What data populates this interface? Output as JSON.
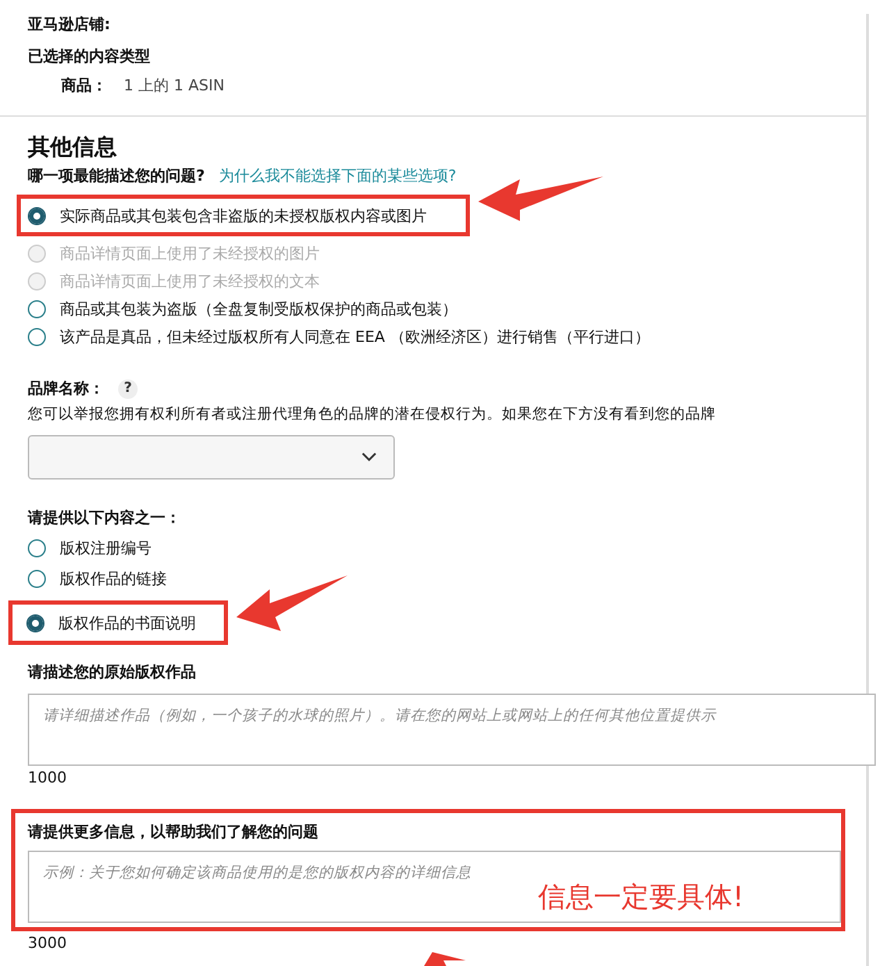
{
  "store_label": "亚马逊店铺:",
  "content_type_label": "已选择的内容类型",
  "item": {
    "label": "商品：",
    "value": "1 上的 1 ASIN"
  },
  "section_title": "其他信息",
  "question": {
    "label": "哪一项最能描述您的问题?",
    "link": "为什么我不能选择下面的某些选项?"
  },
  "issue_options": [
    {
      "label": "实际商品或其包装包含非盗版的未授权版权内容或图片",
      "selected": true,
      "disabled": false,
      "highlighted": true
    },
    {
      "label": "商品详情页面上使用了未经授权的图片",
      "selected": false,
      "disabled": true
    },
    {
      "label": "商品详情页面上使用了未经授权的文本",
      "selected": false,
      "disabled": true
    },
    {
      "label": "商品或其包装为盗版（全盘复制受版权保护的商品或包装）",
      "selected": false,
      "disabled": false
    },
    {
      "label": "该产品是真品，但未经过版权所有人同意在 EEA （欧洲经济区）进行销售（平行进口）",
      "selected": false,
      "disabled": false
    }
  ],
  "brand": {
    "label": "品牌名称：",
    "help": "?",
    "description": "您可以举报您拥有权利所有者或注册代理角色的品牌的潜在侵权行为。如果您在下方没有看到您的品牌"
  },
  "provide": {
    "label": "请提供以下内容之一：",
    "options": [
      {
        "label": "版权注册编号",
        "selected": false
      },
      {
        "label": "版权作品的链接",
        "selected": false
      },
      {
        "label": "版权作品的书面说明",
        "selected": true,
        "highlighted": true
      }
    ]
  },
  "describe": {
    "label": "请描述您的原始版权作品",
    "placeholder": "请详细描述作品（例如，一个孩子的水球的照片）。请在您的网站上或网站上的任何其他位置提供示",
    "counter": "1000"
  },
  "more_info": {
    "label": "请提供更多信息，以帮助我们了解您的问题",
    "placeholder": "示例：关于您如何确定该商品使用的是您的版权内容的详细信息",
    "counter": "3000"
  },
  "annotation_note": "信息一定要具体!"
}
